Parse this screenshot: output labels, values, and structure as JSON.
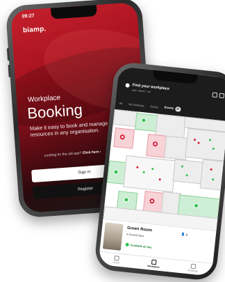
{
  "left_screen": {
    "status_time": "09:27",
    "logo": "biamp.",
    "eyebrow": "Workplace",
    "title": "Booking",
    "tagline": "Make it easy to book and manage bookable resources in any organisation.",
    "old_app_text": "Looking for the old app?",
    "old_app_link": "Click here ›",
    "sign_in": "Sign in",
    "register": "Register"
  },
  "right_screen": {
    "header_title": "Find your workplace",
    "header_subtitle": "Ljan › Room › 1st",
    "tabs": [
      {
        "label": "All"
      },
      {
        "label": "My bookings"
      },
      {
        "label": "Desks"
      },
      {
        "label": "Rooms",
        "badge": "20"
      }
    ],
    "room_card": {
      "name": "Green Room",
      "floor": "Ground floor",
      "capacity": "8",
      "availability": "Available all day"
    },
    "bottom_nav": [
      "Home",
      "Workplace",
      "Bookings"
    ]
  },
  "colors": {
    "brand_red": "#c51f2c",
    "available_green": "#2ec04f",
    "booked_red": "#d91f3a"
  }
}
